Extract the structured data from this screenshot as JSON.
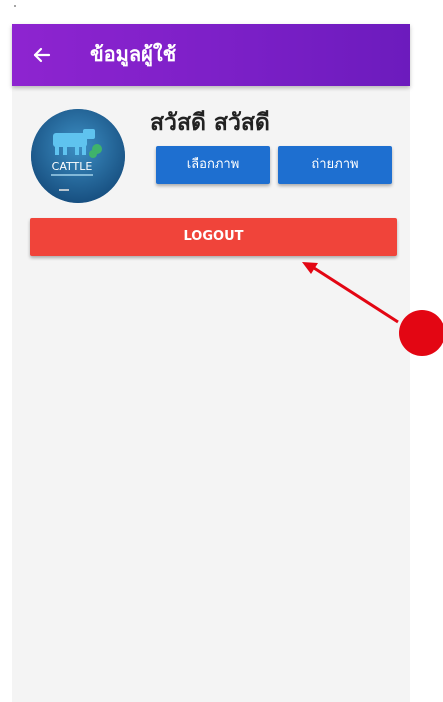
{
  "appbar": {
    "title": "ข้อมูลผู้ใช้",
    "back_icon": "arrow-left-icon",
    "color": "#7a1fc6"
  },
  "profile": {
    "avatar_text": "CATTLE",
    "name": "สวัสดี สวัสดี"
  },
  "actions": {
    "pick_image_label": "เลือกภาพ",
    "take_photo_label": "ถ่ายภาพ",
    "button_color": "#1e6fd0"
  },
  "logout": {
    "label": "LOGOUT",
    "color": "#f0443a"
  },
  "annotation": {
    "color": "#e30613"
  }
}
